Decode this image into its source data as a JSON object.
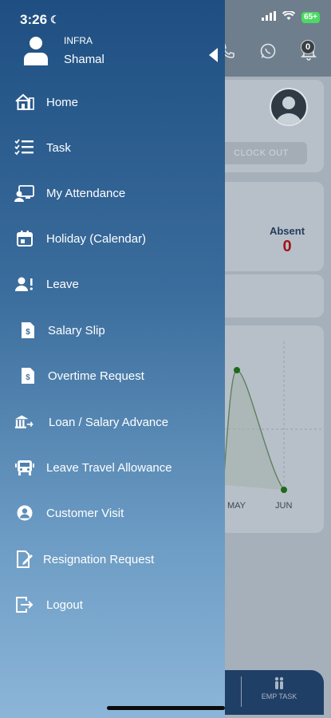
{
  "status_bar": {
    "time": "3:26",
    "battery": "65+"
  },
  "user": {
    "org": "INFRA",
    "name": "Shamal"
  },
  "header": {
    "notification_count": "0"
  },
  "attendance": {
    "absent_label": "Absent",
    "absent_value": "0"
  },
  "clock_out_label": "CLOCK OUT",
  "chart": {
    "months": [
      "MAY",
      "JUN"
    ]
  },
  "bottom_nav": {
    "emp_task_label": "EMP TASK"
  },
  "menu": [
    {
      "label": "Home",
      "icon": "home-icon"
    },
    {
      "label": "Task",
      "icon": "task-list-icon"
    },
    {
      "label": "My Attendance",
      "icon": "attendance-icon"
    },
    {
      "label": "Holiday (Calendar)",
      "icon": "calendar-icon"
    },
    {
      "label": "Leave",
      "icon": "leave-icon"
    },
    {
      "label": "Salary Slip",
      "icon": "salary-slip-icon"
    },
    {
      "label": "Overtime Request",
      "icon": "overtime-icon"
    },
    {
      "label": "Loan / Salary Advance",
      "icon": "loan-icon"
    },
    {
      "label": "Leave Travel Allowance",
      "icon": "travel-icon"
    },
    {
      "label": "Customer Visit",
      "icon": "customer-visit-icon"
    },
    {
      "label": "Resignation Request",
      "icon": "resignation-icon"
    },
    {
      "label": "Logout",
      "icon": "logout-icon"
    }
  ]
}
